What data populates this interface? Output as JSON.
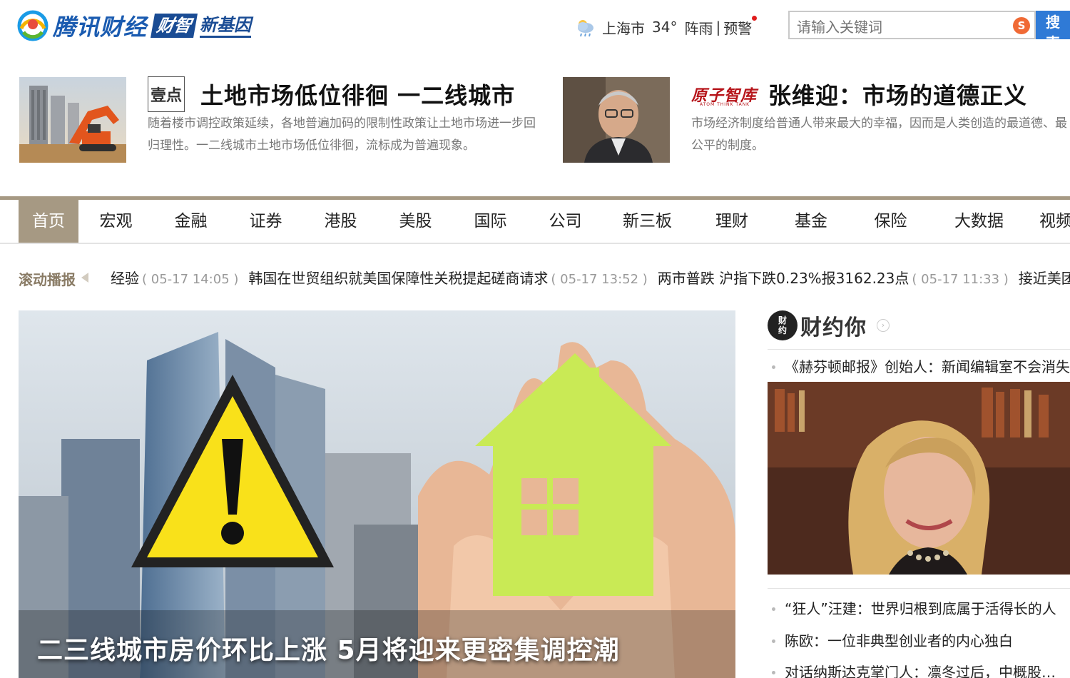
{
  "brand": {
    "name": "腾讯财经",
    "badge": "财智",
    "sub": "新基因"
  },
  "weather": {
    "city": "上海市",
    "temp": "34°",
    "condition": "阵雨",
    "separator": "|",
    "warning": "预警"
  },
  "search": {
    "placeholder": "请输入关键词",
    "button_label": "搜索"
  },
  "headlines": [
    {
      "column_logo": "壹点",
      "title": "土地市场低位徘徊 一二线城市",
      "desc": "随着楼市调控政策延续，各地普遍加码的限制性政策让土地市场进一步回归理性。一二线城市土地市场低位徘徊，流标成为普遍现象。"
    },
    {
      "column_logo": "原子智库",
      "column_logo_sub": "ATOM THINK TANK",
      "title": "张维迎：市场的道德正义",
      "desc": "市场经济制度给普通人带来最大的幸福，因而是人类创造的最道德、最公平的制度。"
    }
  ],
  "nav": {
    "active_index": 0,
    "items": [
      "首页",
      "宏观",
      "金融",
      "证券",
      "港股",
      "美股",
      "国际",
      "公司",
      "新三板",
      "理财",
      "基金",
      "保险",
      "大数据",
      "视频"
    ]
  },
  "ticker": {
    "label": "滚动播报",
    "items": [
      {
        "title": "经验",
        "time": "( 05-17 14:05 )"
      },
      {
        "title": "韩国在世贸组织就美国保障性关税提起磋商请求",
        "time": "( 05-17 13:52 )"
      },
      {
        "title": "两市普跌 沪指下跌0.23%报3162.23点",
        "time": "( 05-17 11:33 )"
      },
      {
        "title": "接近美团",
        "time": ""
      }
    ]
  },
  "hero": {
    "caption": "二三线城市房价环比上涨 5月将迎来更密集调控潮"
  },
  "side": {
    "logo": "财约你",
    "title": "财约你",
    "more_icon": "›",
    "top_item": "《赫芬顿邮报》创始人：新闻编辑室不会消失",
    "items": [
      "“狂人”汪建：世界归根到底属于活得长的人",
      "陈欧：一位非典型创业者的内心独白",
      "对话纳斯达克掌门人：凛冬过后，中概股…"
    ]
  },
  "colors": {
    "nav_accent": "#a69983",
    "brand_blue": "#1a5bb0",
    "search_button": "#2f7ad6",
    "ticker_label": "#8a7c66"
  }
}
